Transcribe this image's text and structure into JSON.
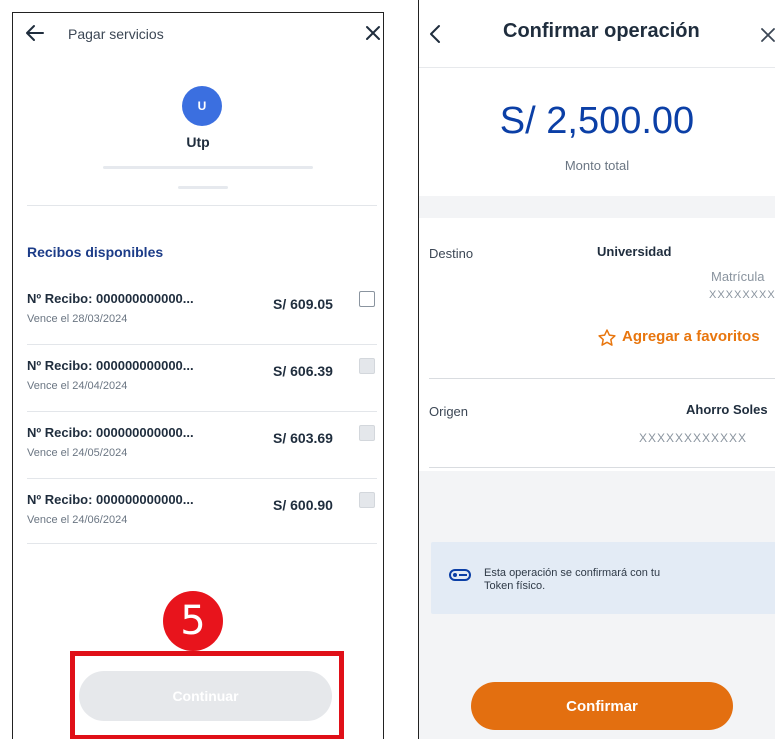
{
  "left": {
    "header": {
      "title": "Pagar servicios"
    },
    "company": {
      "initial": "U",
      "name": "Utp"
    },
    "section_title": "Recibos disponibles",
    "receipts": [
      {
        "number": "Nº Recibo: 000000000000...",
        "due": "Vence el 28/03/2024",
        "amount": "S/ 609.05",
        "selectable": true
      },
      {
        "number": "Nº Recibo: 000000000000...",
        "due": "Vence el 24/04/2024",
        "amount": "S/ 606.39",
        "selectable": false
      },
      {
        "number": "Nº Recibo: 000000000000...",
        "due": "Vence el 24/05/2024",
        "amount": "S/ 603.69",
        "selectable": false
      },
      {
        "number": "Nº Recibo: 000000000000...",
        "due": "Vence el 24/06/2024",
        "amount": "S/ 600.90",
        "selectable": false
      }
    ],
    "step_number": "5",
    "continue_label": "Continuar"
  },
  "right": {
    "header": {
      "title": "Confirmar operación"
    },
    "amount": {
      "value": "S/ 2,500.00",
      "label": "Monto total"
    },
    "destino": {
      "label": "Destino",
      "name": "Universidad",
      "detail_label": "Matrícula",
      "detail_value": "XXXXXXXX",
      "favorite_label": "Agregar a favoritos"
    },
    "origen": {
      "label": "Origen",
      "account": "Ahorro Soles",
      "number": "XXXXXXXXXXXX"
    },
    "info": {
      "line1": "Esta operación se confirmará con tu",
      "line2": "Token físico."
    },
    "confirm_label": "Confirmar"
  },
  "colors": {
    "primary_blue": "#0b3fa6",
    "section_blue": "#1c3c88",
    "avatar_blue": "#3b6fe0",
    "accent_orange": "#e36f10",
    "favorite_orange": "#e8760e",
    "annotation_red": "#e01018",
    "info_bg": "#e3ebf5"
  },
  "icons": {
    "back": "arrow-left-icon",
    "close": "close-icon",
    "chevron_back": "chevron-left-icon",
    "favorite": "star-outline-icon",
    "token": "token-key-icon"
  }
}
